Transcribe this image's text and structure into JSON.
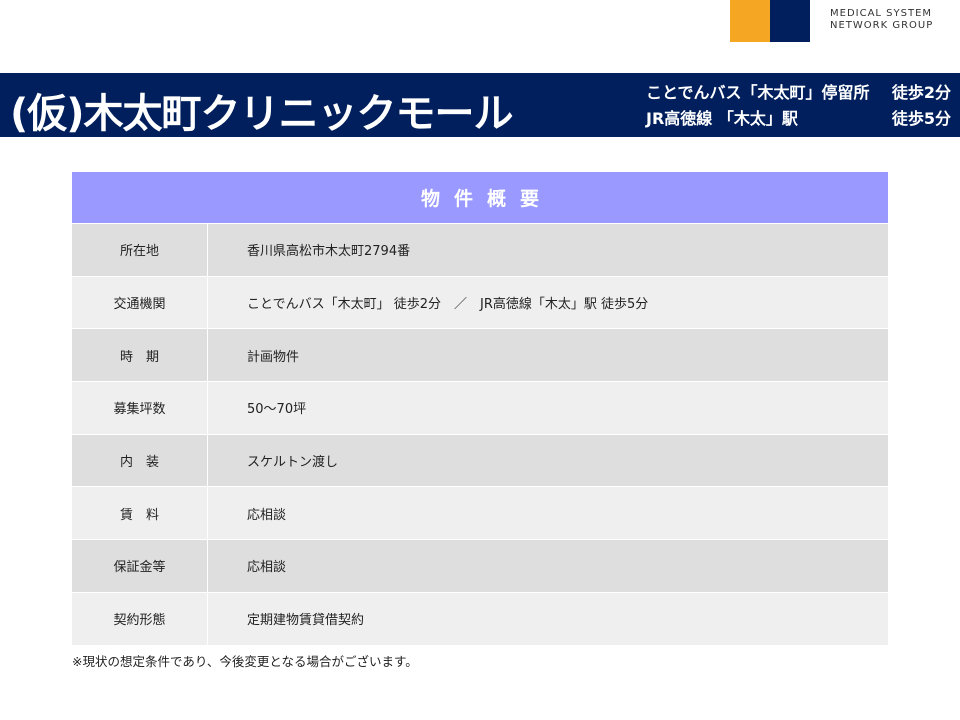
{
  "logo": {
    "line1": "MEDICAL SYSTEM",
    "line2": "NETWORK GROUP",
    "colors": {
      "orange": "#f5a623",
      "navy": "#001f5c"
    }
  },
  "header": {
    "title": "(仮)木太町クリニックモール",
    "access": [
      {
        "line": "ことでんバス「木太町」停留所",
        "walk": "徒歩2分"
      },
      {
        "line": "JR高徳線 「木太」駅",
        "walk": "徒歩5分"
      }
    ]
  },
  "table": {
    "title": "物件概要",
    "rows": [
      {
        "label": "所在地",
        "value": "香川県高松市木太町2794番"
      },
      {
        "label": "交通機関",
        "value": "ことでんバス「木太町」 徒歩2分　／　JR高徳線「木太」駅  徒歩5分"
      },
      {
        "label": "時　期",
        "value": "計画物件"
      },
      {
        "label": "募集坪数",
        "value": "50～70坪"
      },
      {
        "label": "内　装",
        "value": "スケルトン渡し"
      },
      {
        "label": "賃　料",
        "value": "応相談"
      },
      {
        "label": "保証金等",
        "value": "応相談"
      },
      {
        "label": "契約形態",
        "value": "定期建物賃貸借契約"
      }
    ]
  },
  "note": "※現状の想定条件であり、今後変更となる場合がございます。",
  "colors": {
    "header_bg": "#001f5c",
    "table_head_bg": "#9999ff",
    "row_dark": "#dedede",
    "row_light": "#efefef"
  }
}
